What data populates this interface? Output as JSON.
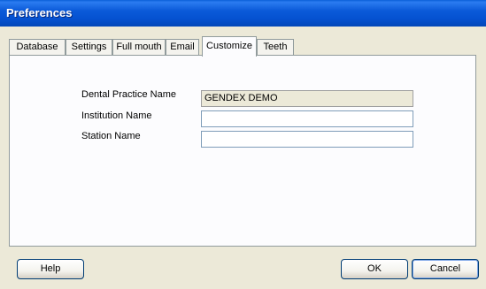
{
  "window": {
    "title": "Preferences"
  },
  "tabs": [
    {
      "label": "Database"
    },
    {
      "label": "Settings"
    },
    {
      "label": "Full mouth"
    },
    {
      "label": "Email"
    },
    {
      "label": "Customize",
      "active": true
    },
    {
      "label": "Teeth"
    }
  ],
  "form": {
    "dental_practice_name": {
      "label": "Dental Practice Name",
      "value": "GENDEX DEMO"
    },
    "institution_name": {
      "label": "Institution Name",
      "value": ""
    },
    "station_name": {
      "label": "Station Name",
      "value": ""
    }
  },
  "buttons": {
    "help": "Help",
    "ok": "OK",
    "cancel": "Cancel"
  }
}
